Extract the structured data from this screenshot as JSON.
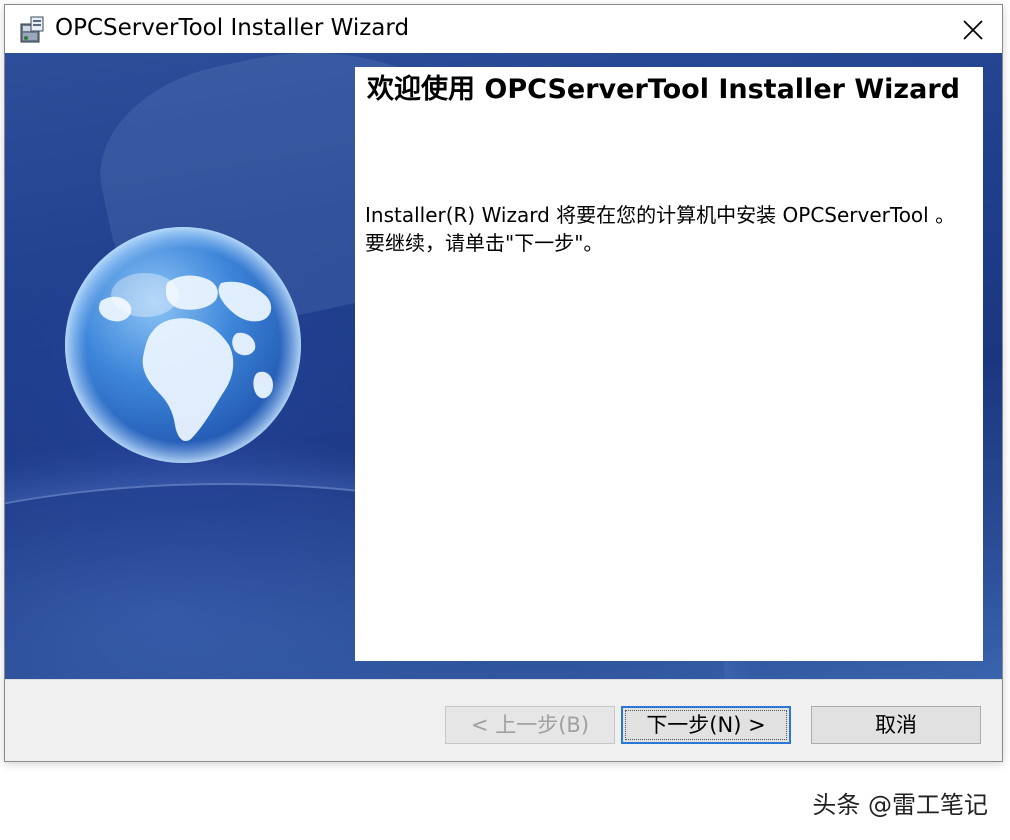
{
  "window": {
    "title": "OPCServerTool Installer Wizard"
  },
  "content": {
    "welcome_title": "欢迎使用 OPCServerTool Installer Wizard",
    "description": "Installer(R) Wizard 将要在您的计算机中安装 OPCServerTool 。 要继续，请单击\"下一步\"。"
  },
  "buttons": {
    "back_label": "< 上一步(B)",
    "next_label": "下一步(N) >",
    "cancel_label": "取消"
  },
  "watermark": {
    "text": "头条 @雷工笔记"
  },
  "colors": {
    "banner": "#1f3f8c",
    "focus_border": "#2a78d4"
  },
  "icons": {
    "title": "installer-icon",
    "close": "close-icon",
    "globe": "globe-icon"
  }
}
